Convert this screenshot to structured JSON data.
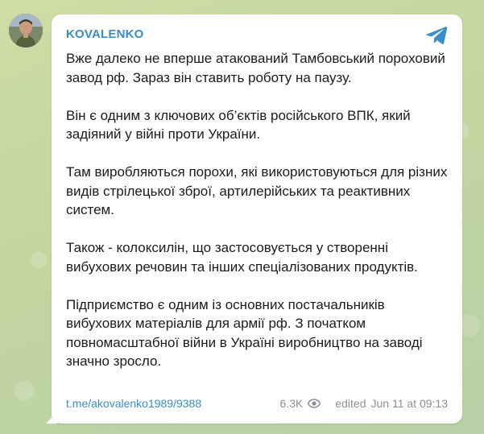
{
  "post": {
    "author": "KOVALENKO",
    "paragraphs": [
      "Вже далеко не вперше атакований Тамбовський пороховий завод рф. Зараз він ставить роботу на паузу.",
      "Він є одним з ключових об’єктів російського ВПК, який задіяний у війні проти України.",
      "Там виробляються порохи, які використовуються для різних видів стрілецької зброї, артилерійських та реактивних систем.",
      "Також - колоксилін, що застосовується у створенні вибухових речовин та інших спеціалізованих продуктів.",
      "Підприємство є одним із основних постачальників вибухових матеріалів для армії рф. З початком повномасштабної війни в Україні виробництво на заводі значно зросло."
    ],
    "link": "t.me/akovalenko1989/9388",
    "views": "6.3K",
    "edited_label": "edited",
    "timestamp": "Jun 11 at 09:13"
  },
  "icons": {
    "share": "telegram-plane-icon",
    "views": "eye-icon"
  },
  "colors": {
    "accent": "#3a8dc7",
    "meta": "#8a8f95",
    "background": "#c6d8a6"
  }
}
